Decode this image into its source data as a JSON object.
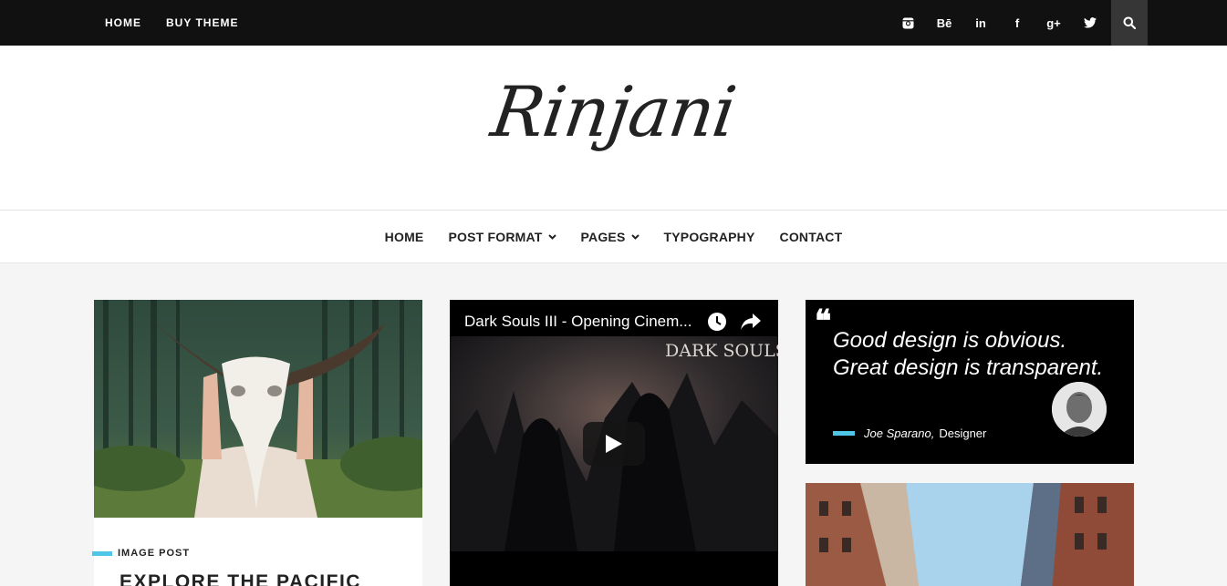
{
  "topbar": {
    "nav": [
      "HOME",
      "BUY THEME"
    ],
    "social_icons": [
      "instagram-icon",
      "behance-icon",
      "linkedin-icon",
      "facebook-icon",
      "google-plus-icon",
      "twitter-icon"
    ],
    "social_glyphs": [
      "◙",
      "Bē",
      "in",
      "f",
      "g+",
      "🐦"
    ]
  },
  "header": {
    "logo": "Rinjani"
  },
  "mainnav": {
    "items": [
      {
        "label": "HOME",
        "dropdown": false
      },
      {
        "label": "POST FORMAT",
        "dropdown": true
      },
      {
        "label": "PAGES",
        "dropdown": true
      },
      {
        "label": "TYPOGRAPHY",
        "dropdown": false
      },
      {
        "label": "CONTACT",
        "dropdown": false
      }
    ]
  },
  "post1": {
    "category": "IMAGE POST",
    "title": "EXPLORE THE PACIFIC"
  },
  "video": {
    "title": "Dark Souls III - Opening Cinem...",
    "overlay_text": "DARK SOULS"
  },
  "quote": {
    "text": "Good design is obvious. Great design is transparent.",
    "author": "Joe Sparano,",
    "role": "Designer"
  },
  "colors": {
    "accent": "#4fc6e8",
    "topbar": "#111111",
    "search_bg": "#363636"
  }
}
